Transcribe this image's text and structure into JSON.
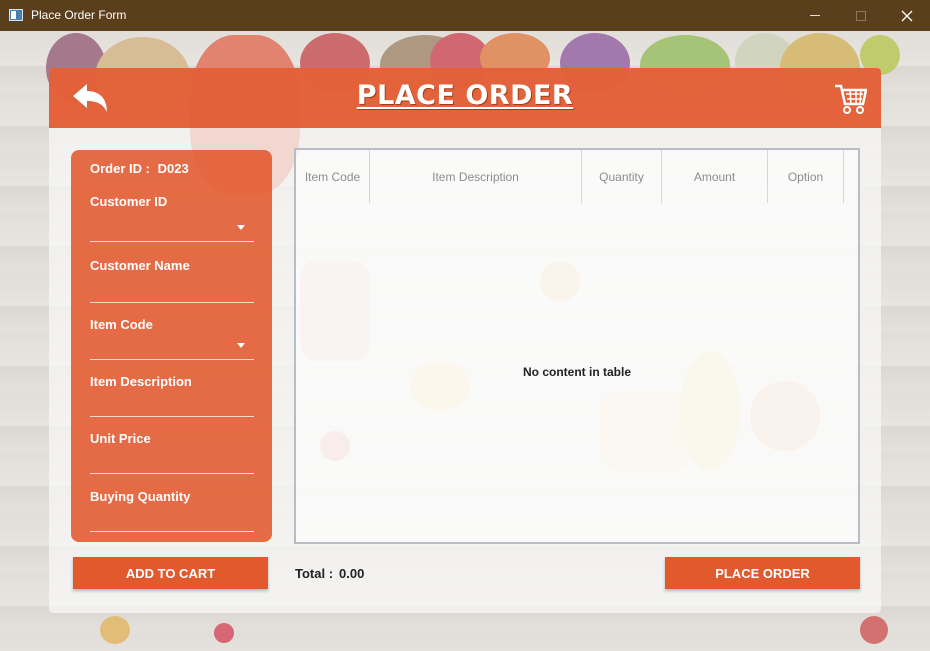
{
  "window": {
    "title": "Place Order Form",
    "minimize_glyph": "—",
    "maximize_glyph": "☐",
    "close_glyph": "✕"
  },
  "header": {
    "title": "PLACE ORDER",
    "back_icon": "back-arrow-icon",
    "cart_icon": "shopping-cart-icon"
  },
  "form": {
    "order_id_label": "Order ID :",
    "order_id_value": "D023",
    "fields": [
      {
        "label": "Customer ID",
        "value": "",
        "type": "dropdown"
      },
      {
        "label": "Customer Name",
        "value": "",
        "type": "text"
      },
      {
        "label": "Item Code",
        "value": "",
        "type": "dropdown"
      },
      {
        "label": "Item Description",
        "value": "",
        "type": "text"
      },
      {
        "label": "Unit Price",
        "value": "",
        "type": "text"
      },
      {
        "label": "Buying Quantity",
        "value": "",
        "type": "text"
      }
    ]
  },
  "table": {
    "columns": [
      "Item Code",
      "Item Description",
      "Quantity",
      "Amount",
      "Option"
    ],
    "rows": [],
    "empty_message": "No content in table"
  },
  "footer": {
    "add_to_cart_label": "ADD TO CART",
    "total_label": "Total :",
    "total_value": "0.00",
    "place_order_label": "PLACE ORDER"
  },
  "colors": {
    "accent": "#e15a2e",
    "titlebar": "#5b3f1c"
  }
}
